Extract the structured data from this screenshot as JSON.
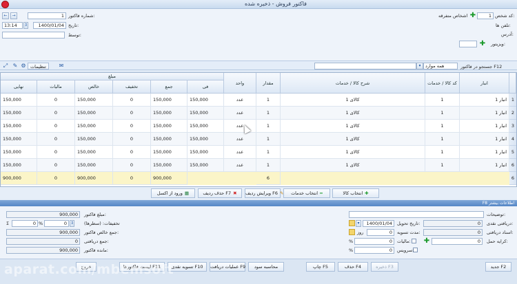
{
  "window": {
    "title": "فاکتور فروش - ذخیره شده"
  },
  "header": {
    "left": {
      "invoice_no_label": "شماره فاکتور:",
      "invoice_no_value": "1",
      "date_label": "تاریخ:",
      "date_value": "1400/01/04",
      "time_value": "13:14",
      "by_label": "توسط:",
      "by_value": ""
    },
    "right": {
      "person_code_label": "کد شخص:",
      "person_code_value": "1",
      "person_name": "اشخاص متفرقه",
      "phone_label": "تلفن ها:",
      "address_label": "آدرس:",
      "visitor_label": "ویزیتور:"
    }
  },
  "toolbar": {
    "settings_label": "تنظیمات",
    "search_label": "جستجو در فاکتور F12",
    "search_scope": "همه موارد"
  },
  "grid": {
    "columns": {
      "warehouse": "انبار",
      "item_code": "کد کالا / خدمات",
      "description": "شرح کالا / خدمات",
      "quantity": "مقدار",
      "unit": "واحد",
      "amount_group": "مبلغ",
      "unit_price": "فی",
      "total": "جمع",
      "discount": "تخفیف",
      "net": "خالص",
      "tax": "مالیات",
      "final": "نهایی"
    },
    "rows": [
      {
        "num": "1",
        "warehouse": "انبار 1",
        "code": "1",
        "desc": "کالای 1",
        "qty": "1",
        "unit": "عدد",
        "price": "150,000",
        "total": "150,000",
        "discount": "0",
        "net": "150,000",
        "tax": "0",
        "final": "150,000"
      },
      {
        "num": "2",
        "warehouse": "انبار 1",
        "code": "1",
        "desc": "کالای 1",
        "qty": "1",
        "unit": "عدد",
        "price": "150,000",
        "total": "150,000",
        "discount": "0",
        "net": "150,000",
        "tax": "0",
        "final": "150,000"
      },
      {
        "num": "3",
        "warehouse": "انبار 1",
        "code": "1",
        "desc": "کالای 1",
        "qty": "1",
        "unit": "عدد",
        "price": "150,000",
        "total": "150,000",
        "discount": "0",
        "net": "150,000",
        "tax": "0",
        "final": "150,000"
      },
      {
        "num": "4",
        "warehouse": "انبار 1",
        "code": "1",
        "desc": "کالای 1",
        "qty": "1",
        "unit": "عدد",
        "price": "150,000",
        "total": "150,000",
        "discount": "0",
        "net": "150,000",
        "tax": "0",
        "final": "150,000"
      },
      {
        "num": "5",
        "warehouse": "انبار 1",
        "code": "1",
        "desc": "کالای 1",
        "qty": "1",
        "unit": "عدد",
        "price": "150,000",
        "total": "150,000",
        "discount": "0",
        "net": "150,000",
        "tax": "0",
        "final": "150,000"
      },
      {
        "num": "6",
        "warehouse": "انبار 1",
        "code": "1",
        "desc": "کالای 1",
        "qty": "1",
        "unit": "عدد",
        "price": "150,000",
        "total": "150,000",
        "discount": "0",
        "net": "150,000",
        "tax": "0",
        "final": "150,000"
      }
    ],
    "totals": {
      "num": "6",
      "qty": "6",
      "total": "900,000",
      "discount": "0",
      "net": "900,000",
      "tax": "0",
      "final": "900,000"
    }
  },
  "actions": {
    "select_item": "انتخاب کالا",
    "select_service": "انتخاب خدمات",
    "edit_row": "ویرایش ردیف F6",
    "delete_row": "حذف ردیف F7",
    "import_excel": "ورود از اکسل"
  },
  "more_info_bar": "F8 اطلاعات بیشتر",
  "summary": {
    "invoice_amount_label": "مبلغ فاکتور:",
    "invoice_amount": "900,000",
    "discounts_label": "تخفیفات: (سطرها)",
    "discount_percent": "0",
    "discount_amount": "0",
    "percent_sign": "%",
    "net_total_label": "جمع خالص فاکتور:",
    "net_total": "900,000",
    "received_total_label": "جمع دریافتی:",
    "received_total": "0",
    "remaining_label": "مانده فاکتور:",
    "remaining": "900,000"
  },
  "details": {
    "notes_label": "توضیحات:",
    "delivery_date_label": "تاریخ تحویل:",
    "delivery_date": "1400/01/04",
    "settlement_label": "مدت تسویه:",
    "settlement_value": "0",
    "settlement_unit": "روز",
    "tax_label": "مالیات:",
    "tax_value": "0",
    "service_label": "سرویس:",
    "service_value": "0",
    "cash_received_label": "دریافتی نقدی:",
    "cash_received": "0",
    "cheques_label": "اسناد دریافتی:",
    "cheques": "0",
    "freight_label": "کرایه حمل:",
    "freight": "0"
  },
  "footer": {
    "new": "جدید F2",
    "save": "ذخیره F3",
    "delete": "حذف F4",
    "print": "چاپ F5",
    "profit": "محاسبه سود",
    "receive_ops": "عملیات دریافت F9",
    "cash_settle": "تسویه نقدی F10",
    "list": "لیست فاکتورها F11",
    "exit": "خروج"
  },
  "watermark": "aparat.com/mbemsoft"
}
